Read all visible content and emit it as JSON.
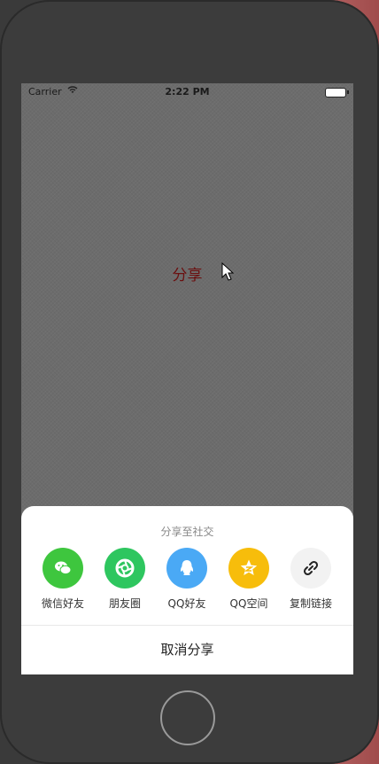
{
  "statusbar": {
    "carrier": "Carrier",
    "time": "2:22 PM"
  },
  "main": {
    "share_link": "分享"
  },
  "share_sheet": {
    "title": "分享至社交",
    "targets": [
      {
        "label": "微信好友",
        "icon": "wechat-icon",
        "color": "#3ec63e"
      },
      {
        "label": "朋友圈",
        "icon": "moments-icon",
        "color": "#2ec65f"
      },
      {
        "label": "QQ好友",
        "icon": "qq-icon",
        "color": "#4aa9f5"
      },
      {
        "label": "QQ空间",
        "icon": "qzone-icon",
        "color": "#f7bd0b"
      },
      {
        "label": "复制链接",
        "icon": "link-icon",
        "color": "#f2f2f2"
      }
    ],
    "cancel": "取消分享"
  }
}
